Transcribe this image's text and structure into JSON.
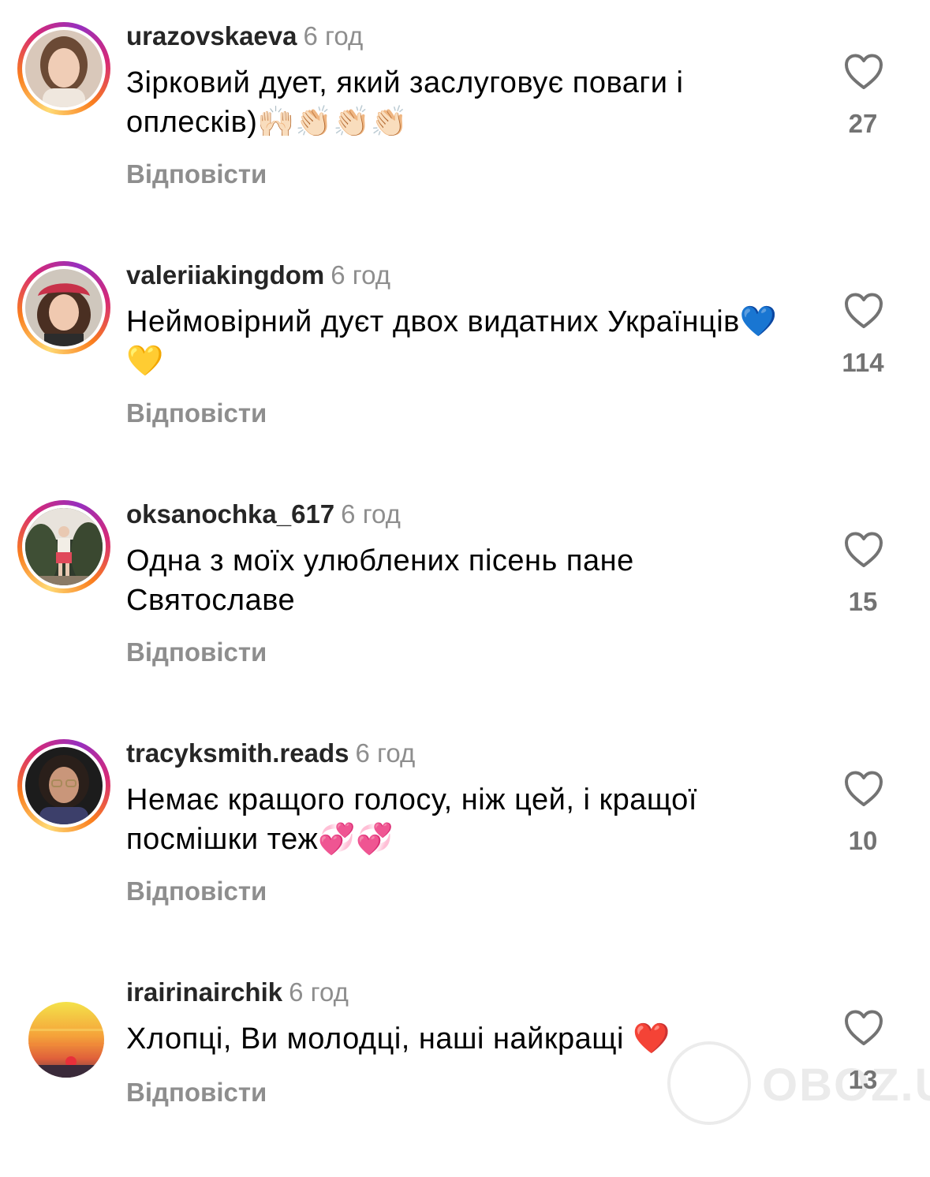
{
  "comments": [
    {
      "username": "urazovskaeva",
      "time": "6 год",
      "text": "Зірковий дует, який заслуговує поваги і оплесків)🙌🏻👏🏻👏🏻👏🏻",
      "reply_label": "Відповісти",
      "likes": "27",
      "has_story_ring": true
    },
    {
      "username": "valeriiakingdom",
      "time": "6 год",
      "text": "Неймовірний дуєт двох видатних Українців💙💛",
      "reply_label": "Відповісти",
      "likes": "114",
      "has_story_ring": true
    },
    {
      "username": "oksanochka_617",
      "time": "6 год",
      "text": "Одна з моїх улюблених пісень пане Святославе",
      "reply_label": "Відповісти",
      "likes": "15",
      "has_story_ring": true
    },
    {
      "username": "tracyksmith.reads",
      "time": "6 год",
      "text": "Немає кращого голосу, ніж цей, і кращої посмішки теж💞💞",
      "reply_label": "Відповісти",
      "likes": "10",
      "has_story_ring": true
    },
    {
      "username": "irairinairchik",
      "time": "6 год",
      "text": "Хлопці, Ви молодці, наші найкращі ❤️",
      "reply_label": "Відповісти",
      "likes": "13",
      "has_story_ring": false
    }
  ],
  "watermark": {
    "text": "OBOZ.UA"
  },
  "colors": {
    "username": "#262626",
    "secondary_text": "#8e8e8e",
    "like_count": "#737373",
    "story_ring_start": "#feda75",
    "story_ring_end": "#d62976"
  },
  "icons": {
    "like": "heart-outline-icon"
  }
}
